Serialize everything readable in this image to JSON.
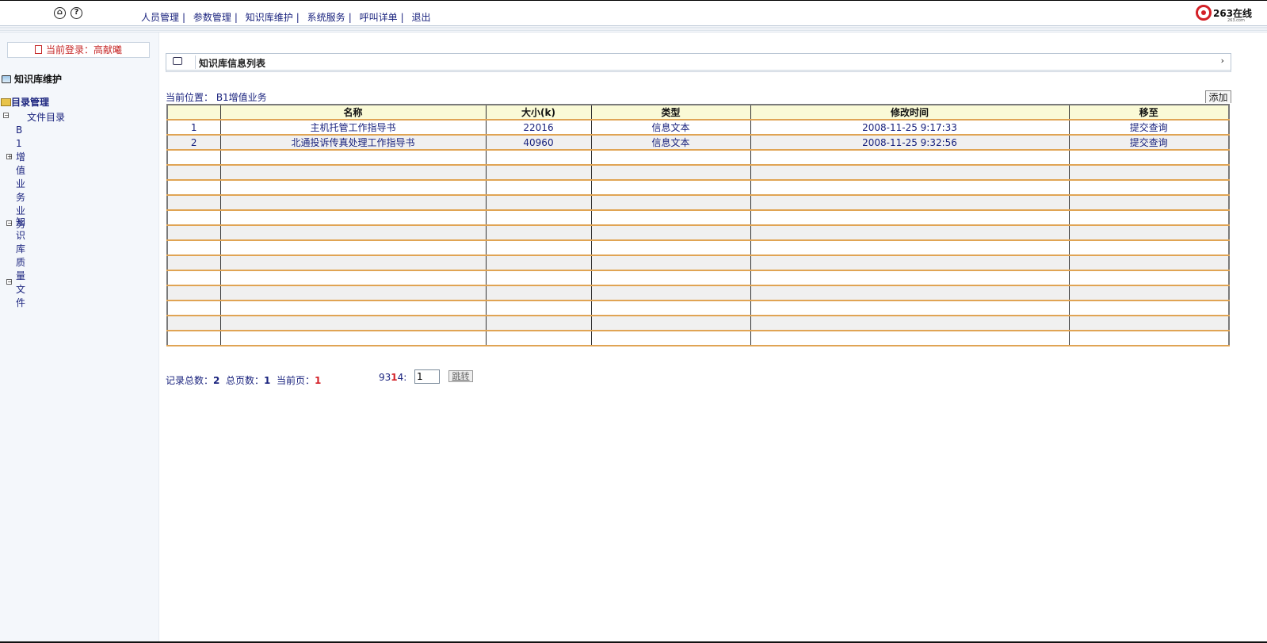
{
  "nav": {
    "items": [
      "人员管理",
      "参数管理",
      "知识库维护",
      "系统服务",
      "呼叫详单",
      "退出"
    ],
    "separator": "|"
  },
  "logo": {
    "text": "263在线",
    "sub": "263.com"
  },
  "sidebar": {
    "login_label": "当前登录：高献曦",
    "section_title": "知识库维护",
    "dir_title": "目录管理",
    "root_label": "文件目录",
    "tree": {
      "node1": "B1增值业务业务",
      "node2": "知识库质量",
      "node3": "文件"
    }
  },
  "panel": {
    "title": "知识库信息列表",
    "arrow": "›"
  },
  "breadcrumb": "当前位置：  B1增值业务",
  "add_label": "添加",
  "table": {
    "headers": [
      "",
      "名称",
      "大小(k)",
      "类型",
      "修改时间",
      "移至"
    ],
    "rows": [
      [
        "1",
        "主机托管工作指导书",
        "22016",
        "信息文本",
        "2008-11-25 9:17:33",
        "提交查询"
      ],
      [
        "2",
        "北通投诉传真处理工作指导书",
        "40960",
        "信息文本",
        "2008-11-25 9:32:56",
        "提交查询"
      ]
    ],
    "empty_rows": 13
  },
  "footer": {
    "total_label": "记录总数：",
    "total": "2",
    "pages_label": "总页数：",
    "pages": "1",
    "current_label": "当前页：",
    "current": "1",
    "goto_prefix": "93",
    "goto_mid": "1",
    "goto_suffix": "4:",
    "page_input": "1",
    "jump_label": "跳转"
  }
}
